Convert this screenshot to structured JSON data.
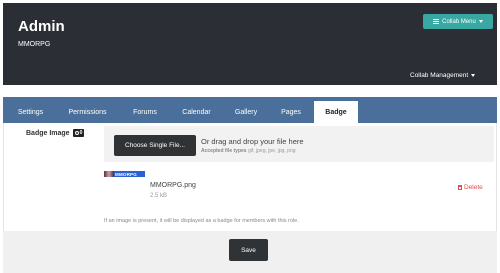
{
  "header": {
    "title": "Admin",
    "subtitle": "MMORPG",
    "collab_menu_label": "Collab Menu",
    "collab_management_label": "Collab Management"
  },
  "tabs": [
    {
      "label": "Settings",
      "active": false
    },
    {
      "label": "Permissions",
      "active": false
    },
    {
      "label": "Forums",
      "active": false
    },
    {
      "label": "Calendar",
      "active": false
    },
    {
      "label": "Gallery",
      "active": false
    },
    {
      "label": "Pages",
      "active": false
    },
    {
      "label": "Badge",
      "active": true
    }
  ],
  "badge_field": {
    "label": "Badge Image",
    "badge_count": "0"
  },
  "upload": {
    "choose_button": "Choose Single File...",
    "drop_text": "Or drag and drop your file here",
    "accepted_label": "Accepted file types",
    "accepted_types": "gif, jpeg, jpe, jpg, png"
  },
  "file": {
    "thumbnail_text": "MMORPG",
    "name": "MMORPG.png",
    "size": "2.5 kB",
    "delete_label": "Delete"
  },
  "help_text": "If an image is present, it will be displayed as a badge for members with this role.",
  "footer": {
    "save_label": "Save"
  },
  "colors": {
    "header_bg": "#2b2f35",
    "accent_teal": "#3aa8a2",
    "tabbar_bg": "#4a6f9a",
    "delete_red": "#e0504a",
    "button_dark": "#2f3336"
  }
}
